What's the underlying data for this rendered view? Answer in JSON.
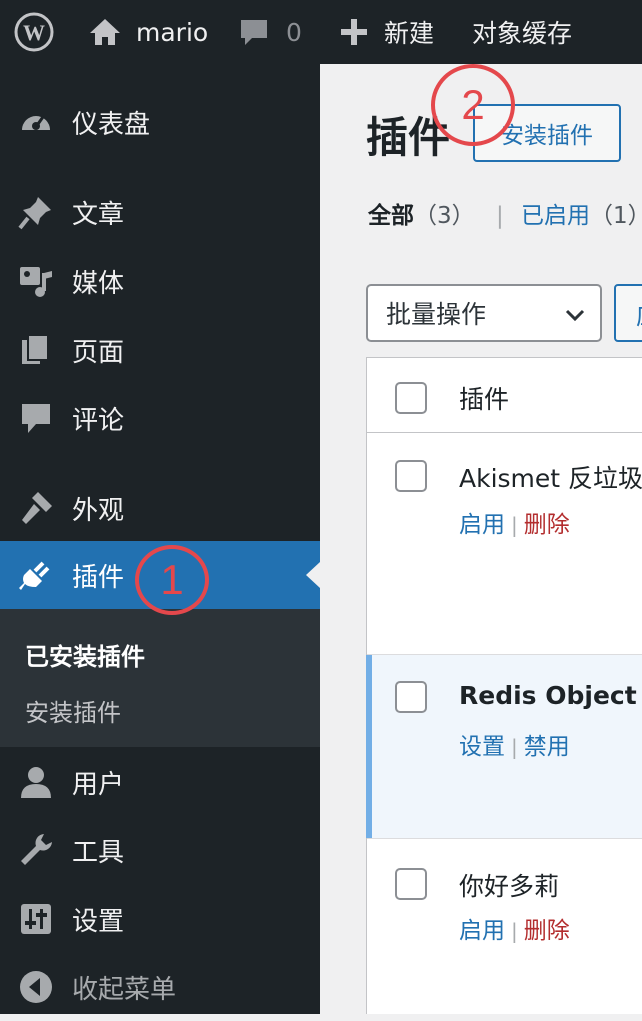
{
  "adminbar": {
    "user": "mario",
    "comments_count": "0",
    "new_label": "新建",
    "object_cache_label": "对象缓存"
  },
  "sidebar": {
    "items": [
      {
        "label": "仪表盘",
        "icon": "dashboard-icon"
      },
      {
        "label": "文章",
        "icon": "pin-icon"
      },
      {
        "label": "媒体",
        "icon": "media-icon"
      },
      {
        "label": "页面",
        "icon": "pages-icon"
      },
      {
        "label": "评论",
        "icon": "comment-icon"
      },
      {
        "label": "外观",
        "icon": "appearance-icon"
      },
      {
        "label": "插件",
        "icon": "plugin-icon"
      },
      {
        "label": "用户",
        "icon": "user-icon"
      },
      {
        "label": "工具",
        "icon": "wrench-icon"
      },
      {
        "label": "设置",
        "icon": "settings-icon"
      },
      {
        "label": "收起菜单",
        "icon": "collapse-icon"
      }
    ],
    "submenu": [
      {
        "label": "已安装插件"
      },
      {
        "label": "安装插件"
      }
    ]
  },
  "main": {
    "title": "插件",
    "add_new": "安装插件",
    "filters": {
      "all_label": "全部",
      "all_count": "（3）",
      "sep": "|",
      "active_label": "已启用",
      "active_count": "（1）"
    },
    "bulk_actions": "批量操作",
    "apply_partial": "应",
    "table": {
      "header": "插件",
      "rows": [
        {
          "name": "Akismet 反垃圾评论",
          "action1": "启用",
          "action2": "删除"
        },
        {
          "name": "Redis Object Cache",
          "action1": "设置",
          "action2": "禁用"
        },
        {
          "name": "你好多莉",
          "action1": "启用",
          "action2": "删除"
        }
      ]
    }
  },
  "annotations": [
    "1",
    "2"
  ],
  "colors": {
    "adminbar_bg": "#1d2327",
    "sidebar_current": "#2271b1",
    "link": "#2271b1",
    "delete": "#b32d2e",
    "marker": "#e4484c"
  }
}
